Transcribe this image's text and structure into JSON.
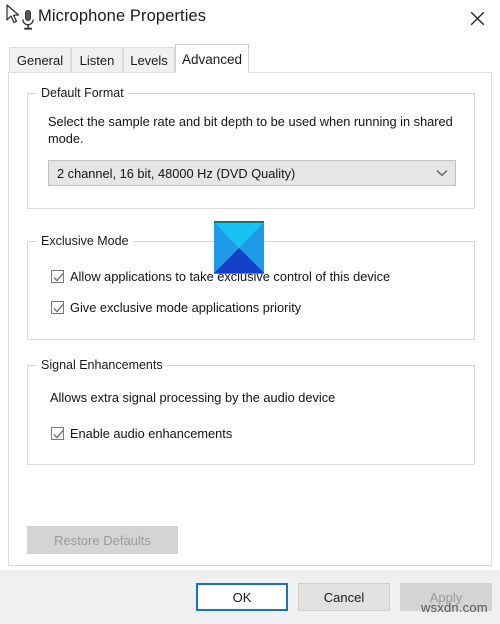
{
  "window": {
    "title": "Microphone Properties",
    "app_icon": "microphone-icon",
    "cursor_icon": "mouse-pointer-icon",
    "close_label": "✕"
  },
  "tabs": [
    {
      "label": "General",
      "active": false
    },
    {
      "label": "Listen",
      "active": false
    },
    {
      "label": "Levels",
      "active": false
    },
    {
      "label": "Advanced",
      "active": true
    }
  ],
  "default_format": {
    "group_label": "Default Format",
    "description": "Select the sample rate and bit depth to be used when running in shared mode.",
    "selected_value": "2 channel, 16 bit, 48000 Hz (DVD Quality)",
    "dropdown_icon": "chevron-down-icon"
  },
  "exclusive_mode": {
    "group_label": "Exclusive Mode",
    "checkboxes": [
      {
        "label": "Allow applications to take exclusive control of this device",
        "checked": true
      },
      {
        "label": "Give exclusive mode applications priority",
        "checked": true
      }
    ]
  },
  "signal_enhancements": {
    "group_label": "Signal Enhancements",
    "description": "Allows extra signal processing by the audio device",
    "checkboxes": [
      {
        "label": "Enable audio enhancements",
        "checked": true
      }
    ]
  },
  "restore": {
    "label": "Restore Defaults",
    "enabled": false
  },
  "footer_buttons": [
    {
      "label": "OK",
      "enabled": true,
      "default": true
    },
    {
      "label": "Cancel",
      "enabled": true,
      "default": false
    },
    {
      "label": "Apply",
      "enabled": false,
      "default": false
    }
  ],
  "watermark": {
    "text": "wsxdn.com"
  },
  "colors": {
    "accent": "#1572c8",
    "logo_top": "#17c3f5",
    "logo_side": "#1e9ae8",
    "logo_bottom": "#1440c8",
    "panel_border": "#dcdcdc",
    "footer_bg": "#f0f0f0"
  }
}
